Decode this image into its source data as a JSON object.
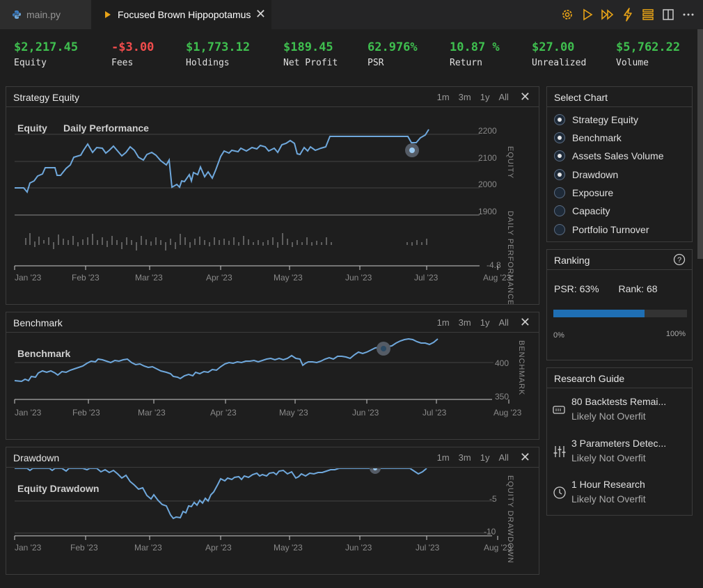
{
  "tabs": [
    {
      "label": "main.py",
      "icon": "python-icon"
    },
    {
      "label": "Focused Brown Hippopotamus",
      "icon": "play-icon"
    }
  ],
  "toolbar_icons": [
    "gear-icon",
    "play-icon",
    "fast-forward-icon",
    "lightning-icon",
    "stack-icon",
    "split-view-icon",
    "more-icon"
  ],
  "accent_color": "#e8a317",
  "stats": [
    {
      "value": "$2,217.45",
      "label": "Equity",
      "color": "green"
    },
    {
      "value": "-$3.00",
      "label": "Fees",
      "color": "red"
    },
    {
      "value": "$1,773.12",
      "label": "Holdings",
      "color": "green"
    },
    {
      "value": "$189.45",
      "label": "Net Profit",
      "color": "green"
    },
    {
      "value": "62.976%",
      "label": "PSR",
      "color": "green"
    },
    {
      "value": "10.87 %",
      "label": "Return",
      "color": "green"
    },
    {
      "value": "$27.00",
      "label": "Unrealized",
      "color": "green"
    },
    {
      "value": "$5,762.22",
      "label": "Volume",
      "color": "green"
    }
  ],
  "range_buttons": [
    "1m",
    "3m",
    "1y",
    "All"
  ],
  "charts": {
    "equity": {
      "title": "Strategy Equity",
      "series_labels": [
        "Equity",
        "Daily Performance"
      ],
      "axis_label": "EQUITY",
      "perf_axis_label": "DAILY PERFORMANCE",
      "y_ticks": [
        "2200",
        "2100",
        "2000",
        "1900"
      ],
      "perf_tick": "-4.8",
      "x_ticks": [
        "Jan '23",
        "Feb '23",
        "Mar '23",
        "Apr '23",
        "May '23",
        "Jun '23",
        "Jul '23",
        "Aug '23"
      ]
    },
    "benchmark": {
      "title": "Benchmark",
      "series_label": "Benchmark",
      "axis_label": "BENCHMARK",
      "y_ticks": [
        "400",
        "350"
      ],
      "x_ticks": [
        "Jan '23",
        "Feb '23",
        "Mar '23",
        "Apr '23",
        "May '23",
        "Jun '23",
        "Jul '23",
        "Aug '23"
      ]
    },
    "drawdown": {
      "title": "Drawdown",
      "series_label": "Equity Drawdown",
      "axis_label": "EQUITY DRAWDOWN",
      "y_ticks": [
        "-5",
        "-10"
      ],
      "x_ticks": [
        "Jan '23",
        "Feb '23",
        "Mar '23",
        "Apr '23",
        "May '23",
        "Jun '23",
        "Jul '23",
        "Aug '23"
      ]
    }
  },
  "select_chart": {
    "title": "Select Chart",
    "options": [
      {
        "label": "Strategy Equity",
        "checked": true
      },
      {
        "label": "Benchmark",
        "checked": true
      },
      {
        "label": "Assets Sales Volume",
        "checked": true
      },
      {
        "label": "Drawdown",
        "checked": true
      },
      {
        "label": "Exposure",
        "checked": false
      },
      {
        "label": "Capacity",
        "checked": false
      },
      {
        "label": "Portfolio Turnover",
        "checked": false
      }
    ]
  },
  "ranking": {
    "title": "Ranking",
    "psr": "PSR: 63%",
    "rank": "Rank: 68",
    "progress": 0.68,
    "min_label": "0%",
    "max_label": "100%"
  },
  "research_guide": {
    "title": "Research Guide",
    "items": [
      {
        "title": "80 Backtests Remai...",
        "status": "Likely Not Overfit",
        "icon": "backtests-icon"
      },
      {
        "title": "3 Parameters Detec...",
        "status": "Likely Not Overfit",
        "icon": "sliders-icon"
      },
      {
        "title": "1 Hour Research",
        "status": "Likely Not Overfit",
        "icon": "clock-icon"
      }
    ]
  }
}
